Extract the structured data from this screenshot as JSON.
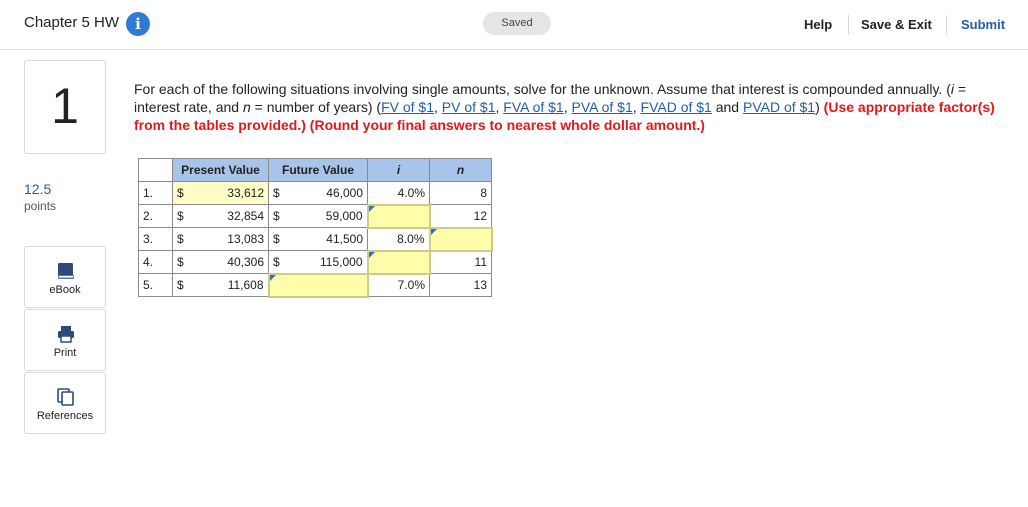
{
  "header": {
    "title": "Chapter 5 HW",
    "info_icon": "info-icon",
    "saved": "Saved",
    "help": "Help",
    "save_exit": "Save & Exit",
    "submit": "Submit"
  },
  "question": {
    "number": "1",
    "points_value": "12.5",
    "points_label": "points",
    "text_1": "For each of the following situations involving single amounts, solve for the unknown. Assume that interest is compounded annually. (",
    "i_var": "i",
    "text_2": " = interest rate, and ",
    "n_var": "n",
    "text_3": " = number of years) (",
    "links": [
      "FV of $1",
      "PV of $1",
      "FVA of $1",
      "PVA of $1",
      "FVAD of $1",
      "PVAD of $1"
    ],
    "sep_comma": ", ",
    "sep_and": " and ",
    "text_4": ") ",
    "instruction": "(Use appropriate factor(s) from the tables provided.) (Round your final answers to nearest whole dollar amount.)"
  },
  "sidebar": {
    "ebook": "eBook",
    "print": "Print",
    "references": "References"
  },
  "table": {
    "headers": {
      "pv": "Present Value",
      "fv": "Future Value",
      "i": "i",
      "n": "n"
    },
    "rows": [
      {
        "num": "1.",
        "pv_cur": "$",
        "pv": "33,612",
        "fv_cur": "$",
        "fv": "46,000",
        "i": "4.0%",
        "n": "8"
      },
      {
        "num": "2.",
        "pv_cur": "$",
        "pv": "32,854",
        "fv_cur": "$",
        "fv": "59,000",
        "i": "",
        "n": "12"
      },
      {
        "num": "3.",
        "pv_cur": "$",
        "pv": "13,083",
        "fv_cur": "$",
        "fv": "41,500",
        "i": "8.0%",
        "n": ""
      },
      {
        "num": "4.",
        "pv_cur": "$",
        "pv": "40,306",
        "fv_cur": "$",
        "fv": "115,000",
        "i": "",
        "n": "11"
      },
      {
        "num": "5.",
        "pv_cur": "$",
        "pv": "11,608",
        "fv_cur": "",
        "fv": "",
        "i": "7.0%",
        "n": "13"
      }
    ]
  }
}
